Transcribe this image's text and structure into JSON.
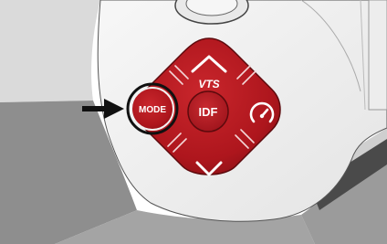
{
  "buttons": {
    "vts": "VTS",
    "mode": "MODE",
    "idf": "IDF"
  },
  "icons": {
    "up": "chevron-up-icon",
    "down": "chevron-down-icon",
    "speedometer": "speedometer-icon",
    "pointer": "arrow-right-icon"
  },
  "colors": {
    "button_red": "#b8151d",
    "button_dark": "#7e0a10",
    "housing": "#f2f2f2",
    "background": "#9a9a9a"
  }
}
